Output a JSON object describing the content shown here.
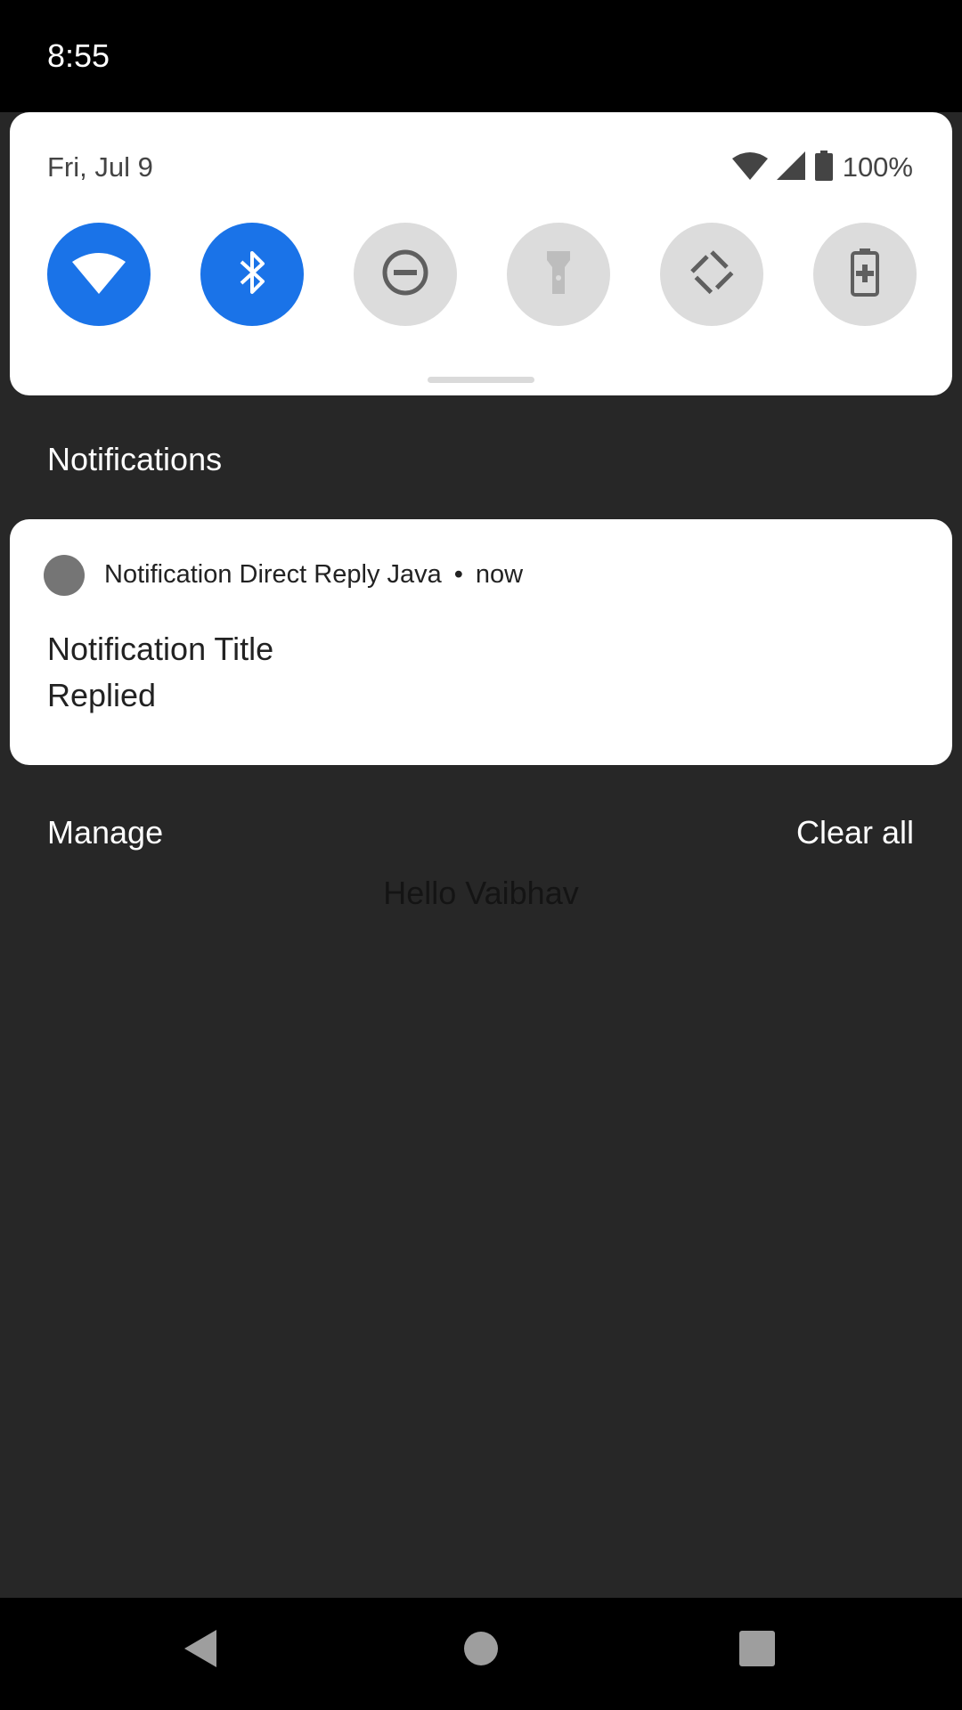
{
  "status_bar": {
    "time": "8:55"
  },
  "quick_settings": {
    "date": "Fri, Jul 9",
    "battery_percent": "100%",
    "tiles": [
      {
        "name": "wifi",
        "icon": "wifi-icon",
        "active": true
      },
      {
        "name": "bluetooth",
        "icon": "bluetooth-icon",
        "active": true
      },
      {
        "name": "do-not-disturb",
        "icon": "do-not-disturb-icon",
        "active": false
      },
      {
        "name": "flashlight",
        "icon": "flashlight-icon",
        "active": false
      },
      {
        "name": "auto-rotate",
        "icon": "auto-rotate-icon",
        "active": false
      },
      {
        "name": "battery-saver",
        "icon": "battery-saver-icon",
        "active": false
      }
    ]
  },
  "notifications": {
    "section_title": "Notifications",
    "items": [
      {
        "app_name": "Notification Direct Reply Java",
        "separator": "•",
        "time": "now",
        "title": "Notification Title",
        "text": "Replied"
      }
    ],
    "manage_label": "Manage",
    "clear_all_label": "Clear all"
  },
  "background_app": {
    "text": "Hello Vaibhav"
  },
  "colors": {
    "accent": "#1a73e8",
    "shade_background": "#272727",
    "card_background": "#ffffff",
    "tile_inactive": "#dcdcdc"
  }
}
